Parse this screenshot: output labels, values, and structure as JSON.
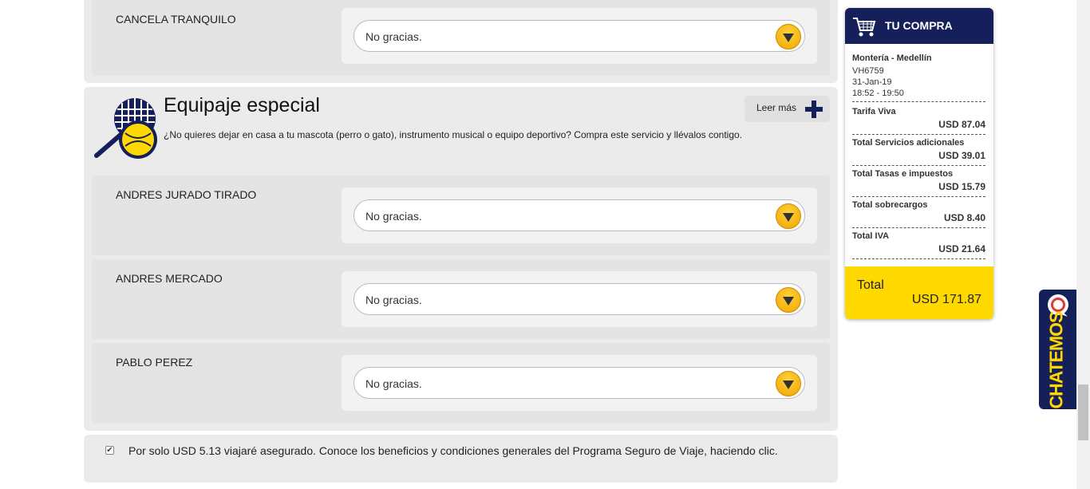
{
  "top_section": {
    "passenger": "CANCELA TRANQUILO",
    "select_value": "No gracias."
  },
  "equipaje": {
    "title": "Equipaje especial",
    "description": "¿No quieres dejar en casa a tu mascota (perro o gato), instrumento musical o equipo deportivo? Compra este servicio y llévalos contigo.",
    "read_more": "Leer más",
    "passengers": [
      {
        "name": "ANDRES JURADO TIRADO",
        "select_value": "No gracias."
      },
      {
        "name": "ANDRES MERCADO",
        "select_value": "No gracias."
      },
      {
        "name": "PABLO PEREZ",
        "select_value": "No gracias."
      }
    ]
  },
  "insurance": {
    "checked_mark": "✔",
    "text": "Por solo USD 5.13 viajaré asegurado. Conoce los beneficios y condiciones generales del Programa Seguro de Viaje, haciendo clic."
  },
  "summary": {
    "title": "TU COMPRA",
    "route": "Montería - Medellín",
    "flight": "VH6759",
    "date": "31-Jan-19",
    "time": "18:52 - 19:50",
    "lines": [
      {
        "label": "Tarifa Viva",
        "amount": "USD 87.04"
      },
      {
        "label": "Total Servicios adicionales",
        "amount": "USD 39.01"
      },
      {
        "label": "Total Tasas e impuestos",
        "amount": "USD 15.79"
      },
      {
        "label": "Total sobrecargos",
        "amount": "USD 8.40"
      },
      {
        "label": "Total IVA",
        "amount": "USD 21.64"
      }
    ],
    "total_label": "Total",
    "total_value": "USD 171.87"
  },
  "chat": {
    "label": "CHATEMOS"
  },
  "colors": {
    "navy": "#15205b",
    "yellow": "#ffd800",
    "panel": "#ebebeb"
  }
}
